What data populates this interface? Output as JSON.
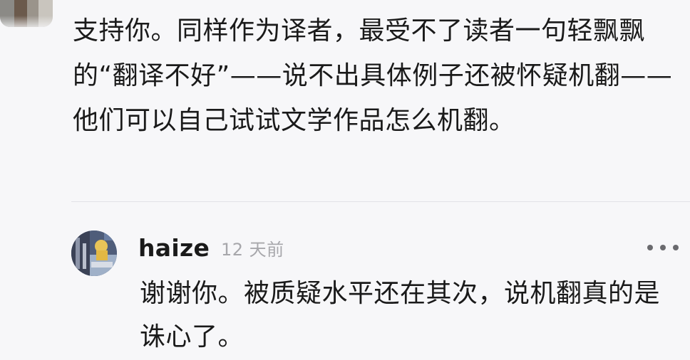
{
  "previous_comment": {
    "text": "支持你。同样作为译者，最受不了读者一句轻飘飘的“翻译不好”——说不出具体例子还被怀疑机翻——他们可以自己试试文学作品怎么机翻。"
  },
  "reply": {
    "username": "haize",
    "timestamp": "12 天前",
    "text": "谢谢你。被质疑水平还在其次，说机翻真的是诛心了。",
    "more_icon": "more-dots-icon"
  },
  "colors": {
    "background": "#f7f7f9",
    "text": "#1a1a1a",
    "muted": "#a7a7ab",
    "divider": "#e2e2e6"
  }
}
